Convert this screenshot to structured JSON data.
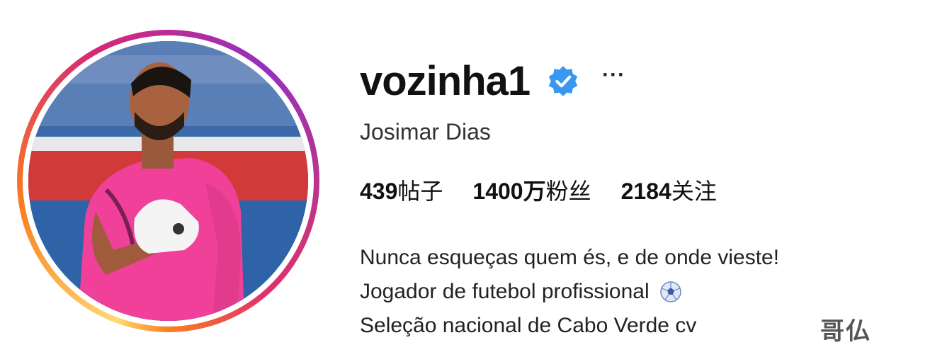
{
  "profile": {
    "username": "vozinha1",
    "verified": true,
    "more_label": "···",
    "full_name": "Josimar Dias",
    "stats": [
      {
        "value": "439",
        "label": "帖子"
      },
      {
        "value": "1400万",
        "label": "粉丝"
      },
      {
        "value": "2184",
        "label": "关注"
      }
    ],
    "bio": [
      "Nunca esqueças quem és, e de onde vieste!",
      "Jogador de futebol profissional",
      "Seleção nacional de Cabo Verde cv"
    ],
    "bio_emoji": "soccer-ball-icon"
  },
  "watermark": {
    "text": "哥仏"
  },
  "colors": {
    "verified_blue": "#3897f0",
    "story_ring": [
      "#feda75",
      "#fa7e1e",
      "#d62976",
      "#962fbf"
    ],
    "jersey_pink": "#f0409a"
  }
}
